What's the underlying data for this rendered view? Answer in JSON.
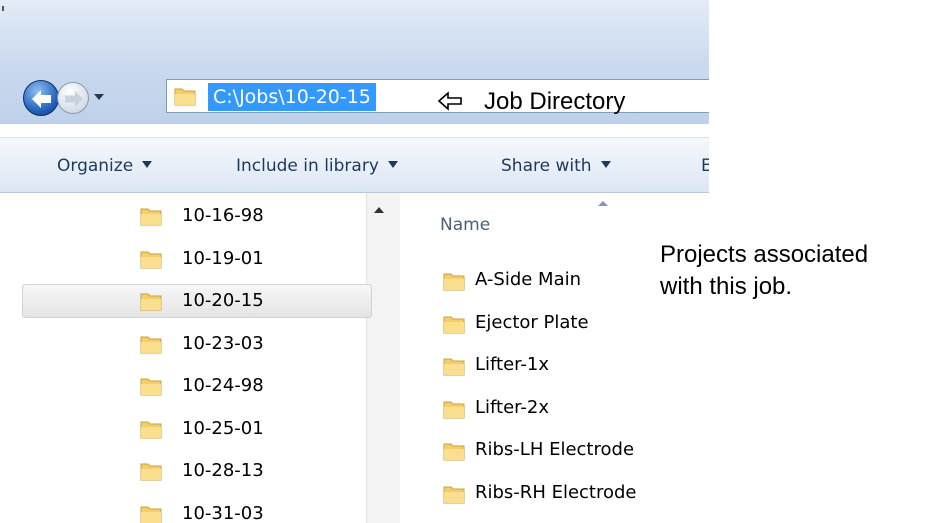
{
  "address_bar": {
    "path": "C:\\Jobs\\10-20-15"
  },
  "annotations": {
    "job_directory_arrow": "⇦",
    "job_directory": "Job Directory",
    "projects_line1": "Projects associated",
    "projects_line2": "with this job."
  },
  "toolbar": {
    "organize": "Organize",
    "include_in_library": "Include in library",
    "share_with": "Share with",
    "truncated": "E"
  },
  "nav_tree": {
    "items": [
      {
        "label": "10-16-98",
        "selected": false
      },
      {
        "label": "10-19-01",
        "selected": false
      },
      {
        "label": "10-20-15",
        "selected": true
      },
      {
        "label": "10-23-03",
        "selected": false
      },
      {
        "label": "10-24-98",
        "selected": false
      },
      {
        "label": "10-25-01",
        "selected": false
      },
      {
        "label": "10-28-13",
        "selected": false
      },
      {
        "label": "10-31-03",
        "selected": false
      }
    ]
  },
  "file_list": {
    "column_name": "Name",
    "items": [
      "A-Side Main",
      "Ejector Plate",
      "Lifter-1x",
      "Lifter-2x",
      "Ribs-LH Electrode",
      "Ribs-RH Electrode"
    ]
  },
  "colors": {
    "selection_blue": "#3399ff",
    "folder_yellow": "#f2cf6b",
    "toolbar_text": "#1e395b"
  },
  "icons": [
    "back-arrow-icon",
    "forward-arrow-icon",
    "dropdown-icon",
    "folder-icon",
    "sort-ascending-icon",
    "left-arrow-icon"
  ]
}
